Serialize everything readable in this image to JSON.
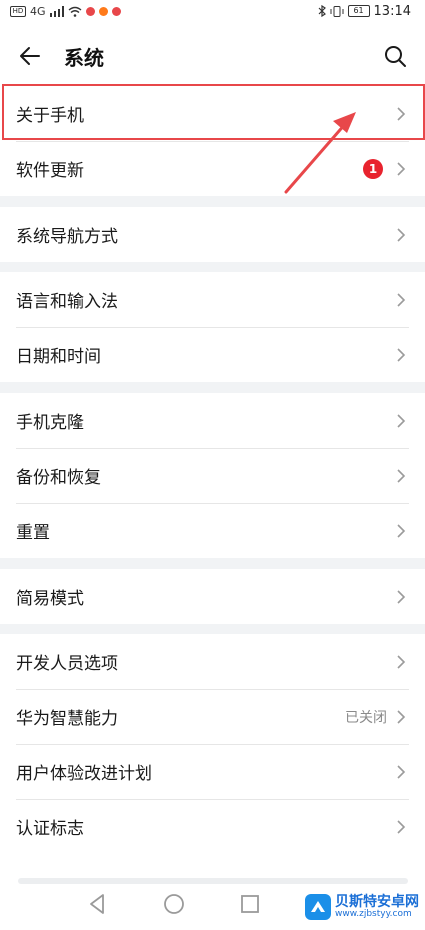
{
  "status_bar": {
    "left_text": "HD",
    "net_text": "4G",
    "time": "13:14",
    "battery": "61"
  },
  "header": {
    "title": "系统",
    "back_icon": "arrow-left-icon",
    "search_icon": "search-icon"
  },
  "groups": [
    {
      "items": [
        {
          "label": "关于手机"
        },
        {
          "label": "软件更新",
          "badge": "1"
        }
      ]
    },
    {
      "items": [
        {
          "label": "系统导航方式"
        }
      ]
    },
    {
      "items": [
        {
          "label": "语言和输入法"
        },
        {
          "label": "日期和时间"
        }
      ]
    },
    {
      "items": [
        {
          "label": "手机克隆"
        },
        {
          "label": "备份和恢复"
        },
        {
          "label": "重置"
        }
      ]
    },
    {
      "items": [
        {
          "label": "简易模式"
        }
      ]
    },
    {
      "items": [
        {
          "label": "开发人员选项"
        },
        {
          "label": "华为智慧能力",
          "value": "已关闭"
        },
        {
          "label": "用户体验改进计划"
        },
        {
          "label": "认证标志"
        }
      ]
    }
  ],
  "watermark": {
    "title": "贝斯特安卓网",
    "url": "www.zjbstyy.com"
  },
  "colors": {
    "highlight": "#e8474a",
    "badge": "#e8232e",
    "separator_band": "#f1f3f5"
  }
}
